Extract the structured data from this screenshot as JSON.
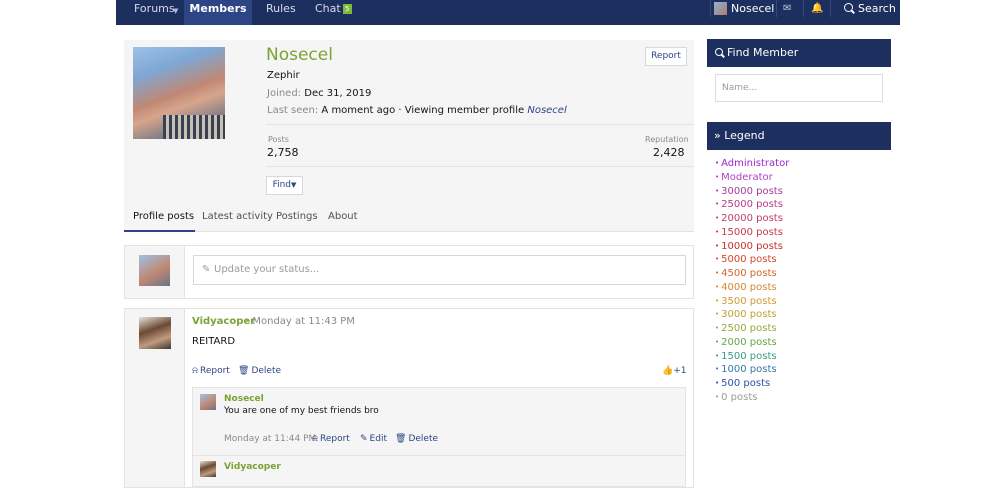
{
  "nav": {
    "forums": "Forums",
    "members": "Members",
    "rules": "Rules",
    "chat": "Chat",
    "chat_badge": "5",
    "user": "Nosecel",
    "search": "Search"
  },
  "profile": {
    "username": "Nosecel",
    "title": "Zephir",
    "joined_label": "Joined:",
    "joined_value": "Dec 31, 2019",
    "last_seen_label": "Last seen:",
    "last_seen_value": "A moment ago · Viewing member profile",
    "last_seen_user": "Nosecel",
    "report": "Report",
    "posts_label": "Posts",
    "posts_value": "2,758",
    "reputation_label": "Reputation",
    "reputation_value": "2,428",
    "find": "Find"
  },
  "tabs": [
    "Profile posts",
    "Latest activity",
    "Postings",
    "About"
  ],
  "status": {
    "placeholder": "Update your status..."
  },
  "post": {
    "author": "Vidyacoper",
    "time": "· Monday at 11:43 PM",
    "body": "REITARD",
    "report": "Report",
    "delete": "Delete",
    "likes": "+1"
  },
  "comments": [
    {
      "author": "Nosecel",
      "text": "You are one of my best friends bro",
      "time": "Monday at 11:44 PM",
      "report": "Report",
      "edit": "Edit",
      "delete": "Delete"
    },
    {
      "author": "Vidyacoper"
    }
  ],
  "sidebar": {
    "find_member_title": "Find Member",
    "name_placeholder": "Name...",
    "legend_title": "» Legend",
    "legend": [
      {
        "label": "Administrator",
        "color": "#9b27c8"
      },
      {
        "label": "Moderator",
        "color": "#b33fc4"
      },
      {
        "label": "30000 posts",
        "color": "#a83a9e"
      },
      {
        "label": "25000 posts",
        "color": "#b8398a"
      },
      {
        "label": "20000 posts",
        "color": "#c23a6f"
      },
      {
        "label": "15000 posts",
        "color": "#c9394f"
      },
      {
        "label": "10000 posts",
        "color": "#c9302c"
      },
      {
        "label": "5000 posts",
        "color": "#d6452a"
      },
      {
        "label": "4500 posts",
        "color": "#d8632a"
      },
      {
        "label": "4000 posts",
        "color": "#d8872c"
      },
      {
        "label": "3500 posts",
        "color": "#d39b2e"
      },
      {
        "label": "3000 posts",
        "color": "#bea232"
      },
      {
        "label": "2500 posts",
        "color": "#9aa63a"
      },
      {
        "label": "2000 posts",
        "color": "#6aa24a"
      },
      {
        "label": "1500 posts",
        "color": "#3c9a84"
      },
      {
        "label": "1000 posts",
        "color": "#3579a8"
      },
      {
        "label": "500 posts",
        "color": "#2f4fa8"
      },
      {
        "label": "0 posts",
        "color": "#9a9a9a"
      }
    ]
  },
  "colors": {
    "nav_bg": "#1d2f5e",
    "nav_active": "#2d4584",
    "accent_green": "#7ba233",
    "link_blue": "#2d4584"
  }
}
